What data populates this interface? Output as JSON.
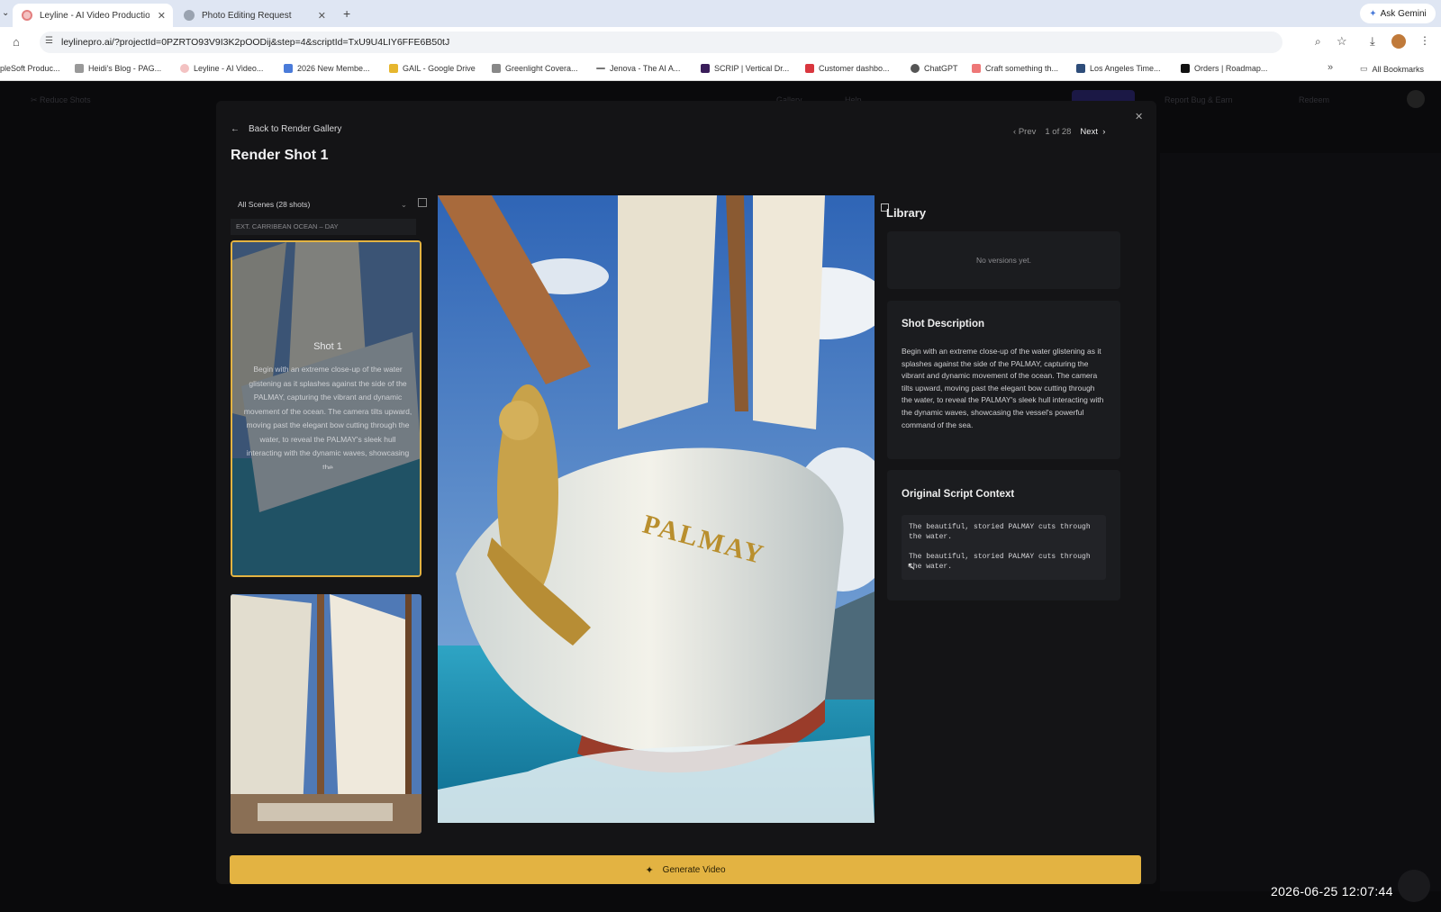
{
  "browser": {
    "tabs": [
      {
        "label": "Leyline - AI Video Production",
        "active": true
      },
      {
        "label": "Photo Editing Request",
        "active": false
      }
    ],
    "ask_gemini": "Ask Gemini",
    "url": "leylinepro.ai/?projectId=0PZRTO93V9I3K2pOODij&step=4&scriptId=TxU9U4LIY6FFE6B50tJ",
    "bookmarks": [
      "pleSoft Produc...",
      "Heidi's Blog - PAG...",
      "Leyline - AI Video...",
      "2026 New Membe...",
      "GAIL - Google Drive",
      "Greenlight Covera...",
      "Jenova - The AI A...",
      "SCRIP | Vertical Dr...",
      "Customer dashbo...",
      "ChatGPT",
      "Craft something th...",
      "Los Angeles Time...",
      "Orders | Roadmap..."
    ],
    "all_bookmarks": "All Bookmarks"
  },
  "app_header": {
    "left": "Reduce Shots",
    "items": [
      "Gallery",
      "Help",
      "Report Bug & Earn",
      "Redeem"
    ]
  },
  "modal": {
    "back_label": "Back to Render Gallery",
    "title": "Render Shot 1",
    "nav": {
      "prev": "Prev",
      "counter": "1 of 28",
      "next": "Next"
    },
    "scene_select": "All Scenes (28 shots)",
    "scene_heading": "EXT. CARRIBEAN OCEAN – DAY",
    "thumb_overlay": {
      "title": "Shot 1",
      "text": "Begin with an extreme close-up of the water glistening as it splashes against the side of the PALMAY, capturing the vibrant and dynamic movement of the ocean. The camera tilts upward, moving past the elegant bow cutting through the water, to reveal the PALMAY's sleek hull interacting with the dynamic waves, showcasing the"
    },
    "main_image_text": "PALMAY",
    "library": {
      "title": "Library",
      "empty": "No versions yet."
    },
    "shot_description": {
      "title": "Shot Description",
      "text": "Begin with an extreme close-up of the water glistening as it splashes against the side of the PALMAY, capturing the vibrant and dynamic movement of the ocean. The camera tilts upward, moving past the elegant bow cutting through the water, to reveal the PALMAY's sleek hull interacting with the dynamic waves, showcasing the vessel's powerful command of the sea."
    },
    "script_context": {
      "title": "Original Script Context",
      "lines": [
        "The beautiful, storied PALMAY cuts through the water.",
        "The beautiful, storied PALMAY cuts through the water."
      ]
    },
    "generate_label": "Generate Video"
  },
  "timestamp": "2026-06-25 12:07:44",
  "colors": {
    "accent": "#e3b342",
    "modal_bg": "#141416",
    "panel_bg": "#1b1c1f"
  }
}
